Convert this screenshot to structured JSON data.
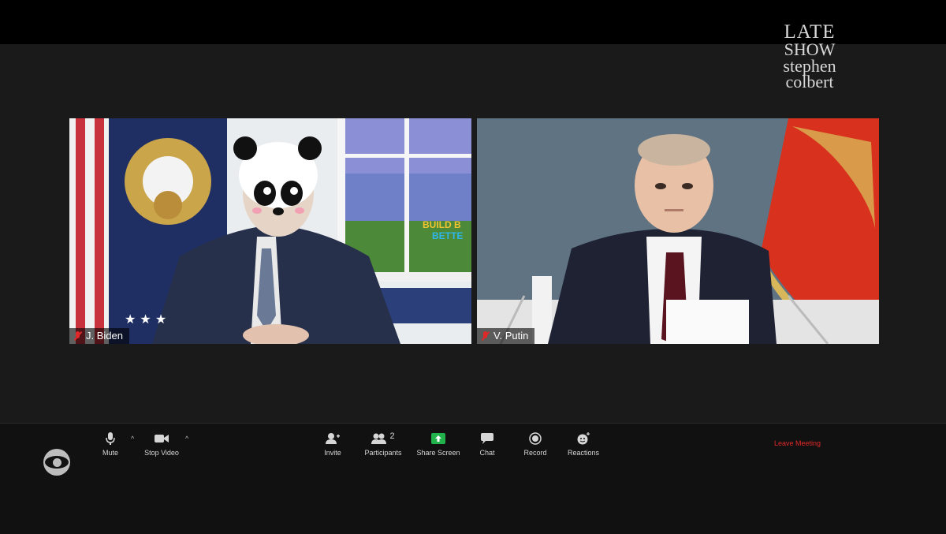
{
  "show_logo": {
    "line1": "LATE",
    "line2": "SHOW",
    "line3": "stephen",
    "line4": "colbert"
  },
  "tiles": [
    {
      "name": "J. Biden",
      "muted": true,
      "banner_line1": "BUILD B",
      "banner_line2": "BETTE"
    },
    {
      "name": "V. Putin",
      "muted": true
    }
  ],
  "toolbar": {
    "mute": "Mute",
    "stop_video": "Stop Video",
    "invite": "Invite",
    "participants": "Participants",
    "participants_count": "2",
    "share_screen": "Share Screen",
    "chat": "Chat",
    "record": "Record",
    "reactions": "Reactions",
    "leave": "Leave Meeting"
  },
  "colors": {
    "accent_green": "#22b24c",
    "leave_red": "#e02828",
    "background": "#1a1a1a"
  },
  "icons": [
    "microphone-icon",
    "video-camera-icon",
    "invite-icon",
    "participants-icon",
    "share-screen-icon",
    "chat-icon",
    "record-icon",
    "reactions-icon",
    "cbs-eye-logo"
  ]
}
